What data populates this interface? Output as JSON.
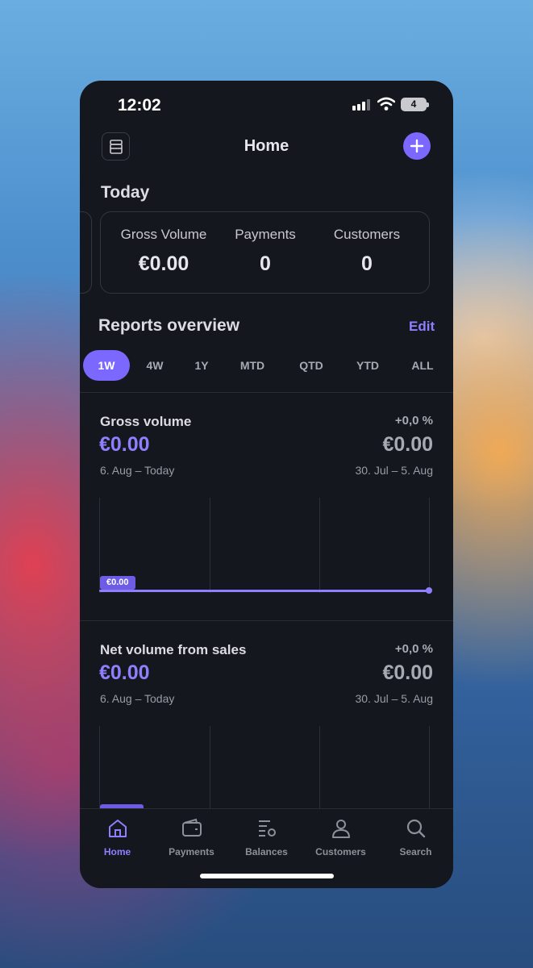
{
  "status_bar": {
    "time": "12:02",
    "battery": "4"
  },
  "header": {
    "title": "Home"
  },
  "today": {
    "title": "Today",
    "metrics": [
      {
        "label": "Gross Volume",
        "value": "€0.00"
      },
      {
        "label": "Payments",
        "value": "0"
      },
      {
        "label": "Customers",
        "value": "0"
      }
    ]
  },
  "reports": {
    "title": "Reports overview",
    "edit_label": "Edit",
    "periods": [
      "1W",
      "4W",
      "1Y",
      "MTD",
      "QTD",
      "YTD",
      "ALL"
    ],
    "active_period": "1W",
    "cards": [
      {
        "title": "Gross volume",
        "change": "+0,0 %",
        "current_value": "€0.00",
        "previous_value": "€0.00",
        "current_range": "6. Aug – Today",
        "previous_range": "30. Jul – 5. Aug",
        "chart_tag": "€0.00"
      },
      {
        "title": "Net volume from sales",
        "change": "+0,0 %",
        "current_value": "€0.00",
        "previous_value": "€0.00",
        "current_range": "6. Aug – Today",
        "previous_range": "30. Jul – 5. Aug"
      }
    ]
  },
  "tabbar": {
    "items": [
      {
        "label": "Home",
        "icon": "home-icon",
        "active": true
      },
      {
        "label": "Payments",
        "icon": "wallet-icon",
        "active": false
      },
      {
        "label": "Balances",
        "icon": "balances-icon",
        "active": false
      },
      {
        "label": "Customers",
        "icon": "person-icon",
        "active": false
      },
      {
        "label": "Search",
        "icon": "search-icon",
        "active": false
      }
    ]
  },
  "colors": {
    "accent": "#7b68ff",
    "background": "#15171e"
  }
}
